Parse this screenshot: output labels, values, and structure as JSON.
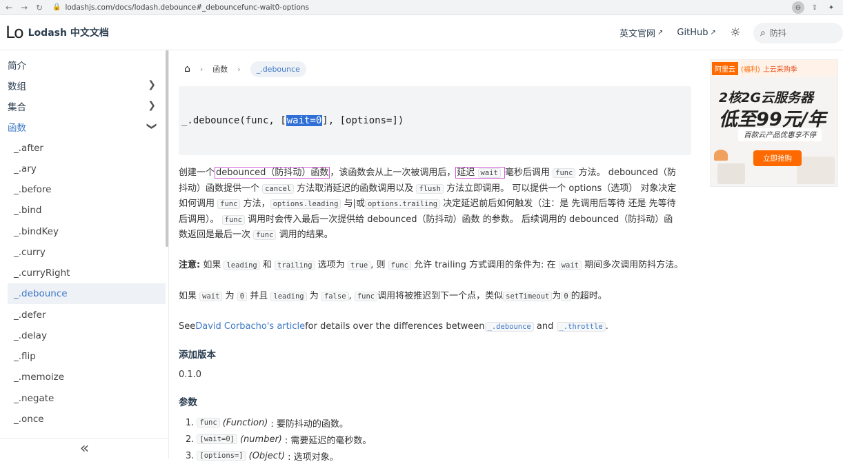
{
  "browser": {
    "url": "lodashjs.com/docs/lodash.debounce#_debouncefunc-wait0-options"
  },
  "header": {
    "logo_text": "Lo",
    "site_title": "Lodash 中文文档",
    "links": [
      {
        "label": "英文官网"
      },
      {
        "label": "GitHub"
      }
    ],
    "search_placeholder": "防抖"
  },
  "sidebar": {
    "top_items": [
      {
        "label": "简介"
      },
      {
        "label": "数组"
      },
      {
        "label": "集合"
      },
      {
        "label": "函数"
      }
    ],
    "sub_items": [
      {
        "label": "_.after"
      },
      {
        "label": "_.ary"
      },
      {
        "label": "_.before"
      },
      {
        "label": "_.bind"
      },
      {
        "label": "_.bindKey"
      },
      {
        "label": "_.curry"
      },
      {
        "label": "_.curryRight"
      },
      {
        "label": "_.debounce"
      },
      {
        "label": "_.defer"
      },
      {
        "label": "_.delay"
      },
      {
        "label": "_.flip"
      },
      {
        "label": "_.memoize"
      },
      {
        "label": "_.negate"
      },
      {
        "label": "_.once"
      }
    ],
    "collapse_glyph": "«"
  },
  "breadcrumb": {
    "section": "函数",
    "current": "_.debounce"
  },
  "signature": {
    "prefix": "_.debounce(func, [",
    "highlight": "wait=0",
    "suffix": "], [options=])"
  },
  "description": {
    "p1_a": "创建一个",
    "p1_debounced": "debounced（防抖动）函数",
    "p1_b": "，该函数会从上一次被调用后，",
    "p1_delay": "延迟",
    "p1_wait": "wait",
    "p1_c": "毫秒后调用",
    "p1_func": "func",
    "p1_d": "方法。 debounced（防",
    "p2_a": "抖动）函数提供一个",
    "p2_cancel": "cancel",
    "p2_b": "方法取消延迟的函数调用以及",
    "p2_flush": "flush",
    "p2_c": "方法立即调用。 可以提供一个 options（选项） 对象决定",
    "p3_a": "如何调用",
    "p3_func": "func",
    "p3_b": "方法，",
    "p3_leading": "options.leading",
    "p3_c": "与|或",
    "p3_trailing": "options.trailing",
    "p3_d": "决定延迟前后如何触发（注：是 先调用后等待 还是 先等待",
    "p4_a": "后调用）。",
    "p4_func": "func",
    "p4_b": "调用时会传入最后一次提供给 debounced（防抖动）函数 的参数。 后续调用的 debounced（防抖动）函",
    "p5_a": "数返回是最后一次",
    "p5_func": "func",
    "p5_b": "调用的结果。"
  },
  "note": {
    "label": "注意:",
    "a": " 如果",
    "leading": "leading",
    "b": "和",
    "trailing": "trailing",
    "c": "选项为",
    "true": "true",
    "d": ", 则",
    "func": "func",
    "e": "允许 trailing 方式调用的条件为: 在",
    "wait": "wait",
    "f": "期间多次调用防抖方法。"
  },
  "note2": {
    "a": "如果",
    "wait": "wait",
    "b": "为",
    "zero": "0",
    "c": "并且",
    "leading": "leading",
    "d": "为",
    "false": "false",
    "e": ",",
    "func": "func",
    "f": "调用将被推迟到下一个点，类似",
    "setTimeout": "setTimeout",
    "g": "为",
    "zero2": "0",
    "h": "的超时。"
  },
  "see": {
    "a": "See",
    "link": "David Corbacho's article",
    "b": "for details over the differences between",
    "debounce": "_.debounce",
    "c": "and",
    "throttle": "_.throttle",
    "d": "."
  },
  "version": {
    "heading": "添加版本",
    "value": "0.1.0"
  },
  "params": {
    "heading": "参数",
    "items": [
      {
        "num": "1.",
        "code": "func",
        "type": "(Function)",
        "desc": ": 要防抖动的函数。"
      },
      {
        "num": "2.",
        "code": "[wait=0]",
        "type": "(number)",
        "desc": ": 需要延迟的毫秒数。"
      },
      {
        "num": "3.",
        "code": "[options=]",
        "type": "(Object)",
        "desc": ": 选项对象。"
      }
    ]
  },
  "ad": {
    "brand": "阿里云",
    "tag1": "(福利)",
    "tag2": "上云采购季",
    "headline1": "2核2G云服务器",
    "headline2": "低至99元/年",
    "sub": "百款云产品优惠享不停",
    "button": "立即抢购"
  }
}
